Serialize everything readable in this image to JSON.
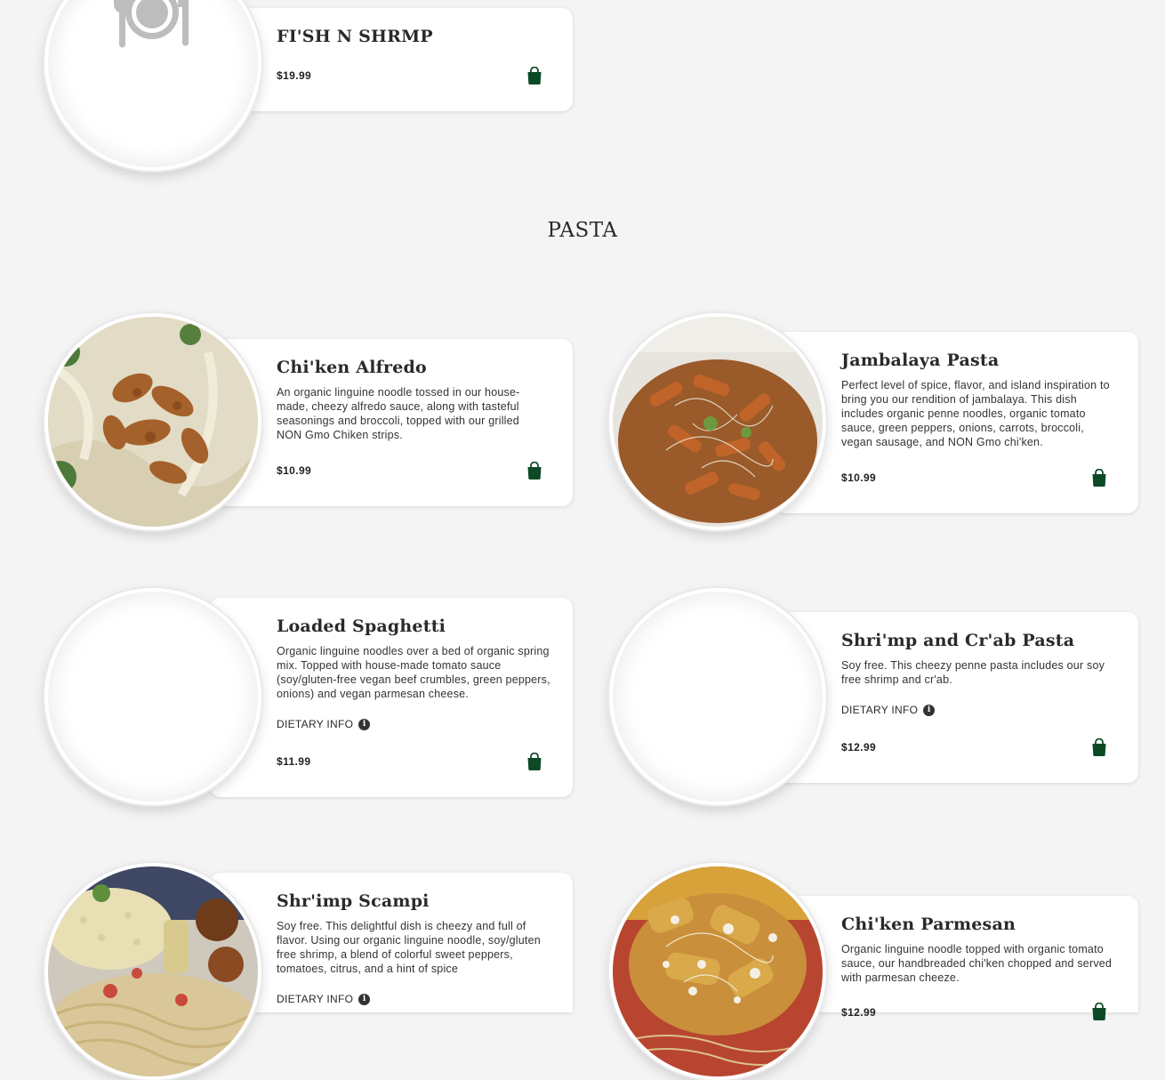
{
  "section": {
    "title": "PASTA"
  },
  "items": [
    {
      "title": "FI'SH N SHRMP",
      "price": "$19.99"
    },
    {
      "title": "Chi'ken Alfredo",
      "description": "An organic linguine noodle tossed in our house-made, cheezy alfredo sauce, along with tasteful seasonings and broccoli, topped with our grilled NON Gmo Chiken strips.",
      "price": "$10.99"
    },
    {
      "title": "Jambalaya Pasta",
      "description": "Perfect level of spice, flavor, and island inspiration to bring you our rendition of jambalaya. This dish includes organic penne noodles, organic tomato sauce, green peppers, onions, carrots, broccoli, vegan sausage, and NON Gmo chi'ken.",
      "price": "$10.99"
    },
    {
      "title": "Loaded Spaghetti",
      "description": "Organic linguine noodles over a bed of organic spring mix. Topped with house-made tomato sauce (soy/gluten-free vegan beef crumbles, green peppers, onions) and vegan parmesan cheese.",
      "dietary": "DIETARY INFO",
      "price": "$11.99"
    },
    {
      "title": "Shri'mp and Cr'ab Pasta",
      "description": "Soy free. This cheezy penne pasta includes our soy free shrimp and cr'ab.",
      "dietary": "DIETARY INFO",
      "price": "$12.99"
    },
    {
      "title": "Shr'imp Scampi",
      "description": "Soy free. This delightful dish is cheezy and full of flavor. Using our organic linguine noodle, soy/gluten free shrimp, a blend of colorful sweet peppers, tomatoes, citrus, and a hint of spice",
      "dietary": "DIETARY INFO"
    },
    {
      "title": "Chi'ken Parmesan",
      "description": "Organic linguine noodle topped with organic tomato sauce, our handbreaded chi'ken chopped and served with parmesan cheeze.",
      "price": "$12.99"
    }
  ],
  "icons": {
    "placeholder": "plate-fork-knife-icon",
    "cart": "shopping-bag-icon",
    "info": "info-icon"
  },
  "colors": {
    "accent": "#0c4a26",
    "background": "#f4f4f4"
  }
}
